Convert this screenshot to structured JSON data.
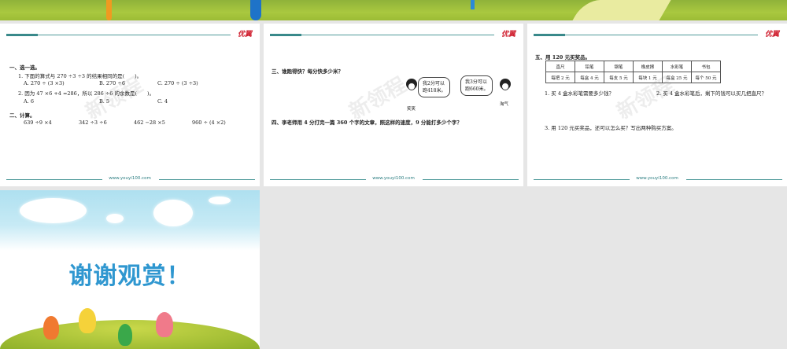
{
  "footer_url": "www.youyi100.com",
  "logo_text": "优翼",
  "watermark": "新领程",
  "slide1": {
    "sec1_title": "一、选一选。",
    "q1": "1. 下面的算式与 270 ÷3 ÷3 的结果相同的是(　　)。",
    "q1_opts": [
      "A. 270 ÷ (3 ×3)",
      "B. 270 ÷6",
      "C. 270 ÷ (3 ÷3)"
    ],
    "q2": "2. 因为 47 ×6 +4 =286，所以 286 ÷6 的余数是(　　)。",
    "q2_opts": [
      "A. 6",
      "B. 5",
      "C. 4"
    ],
    "sec2_title": "二、计算。",
    "calcs": [
      "639 ÷9 ×4",
      "342 ÷3 ÷6",
      "462 −28 ×5",
      "960 ÷ (4 ×2)"
    ]
  },
  "slide2": {
    "sec3_title": "三、谁跑得快？每分快多少米？",
    "bubble1": [
      "我2分可以",
      "跑418米。"
    ],
    "bubble2": [
      "我3分可以",
      "跑660米。"
    ],
    "name1": "笑笑",
    "name2": "淘气",
    "sec4_title": "四、李老师用 4 分打完一篇 360 个字的文章，照这样的速度，9 分能打多少个字？"
  },
  "slide3": {
    "sec5_title": "五、用 120 元买奖品。",
    "table_header": [
      "直尺",
      "铅笔",
      "钢笔",
      "橡皮擦",
      "水彩笔",
      "书包"
    ],
    "table_prices": [
      "每把 2 元",
      "每盒 4 元",
      "每支 5 元",
      "每块 1 元",
      "每盒 25 元",
      "每个 50 元"
    ],
    "q1": "1. 买 4 盒水彩笔需要多少钱？",
    "q2": "2. 买 4 盒水彩笔后，剩下的钱可以买几把直尺？",
    "q3": "3. 用 120 元买奖品，还可以怎么买？写出两种购买方案。"
  },
  "slide4": {
    "thanks": "谢谢观赏！"
  }
}
